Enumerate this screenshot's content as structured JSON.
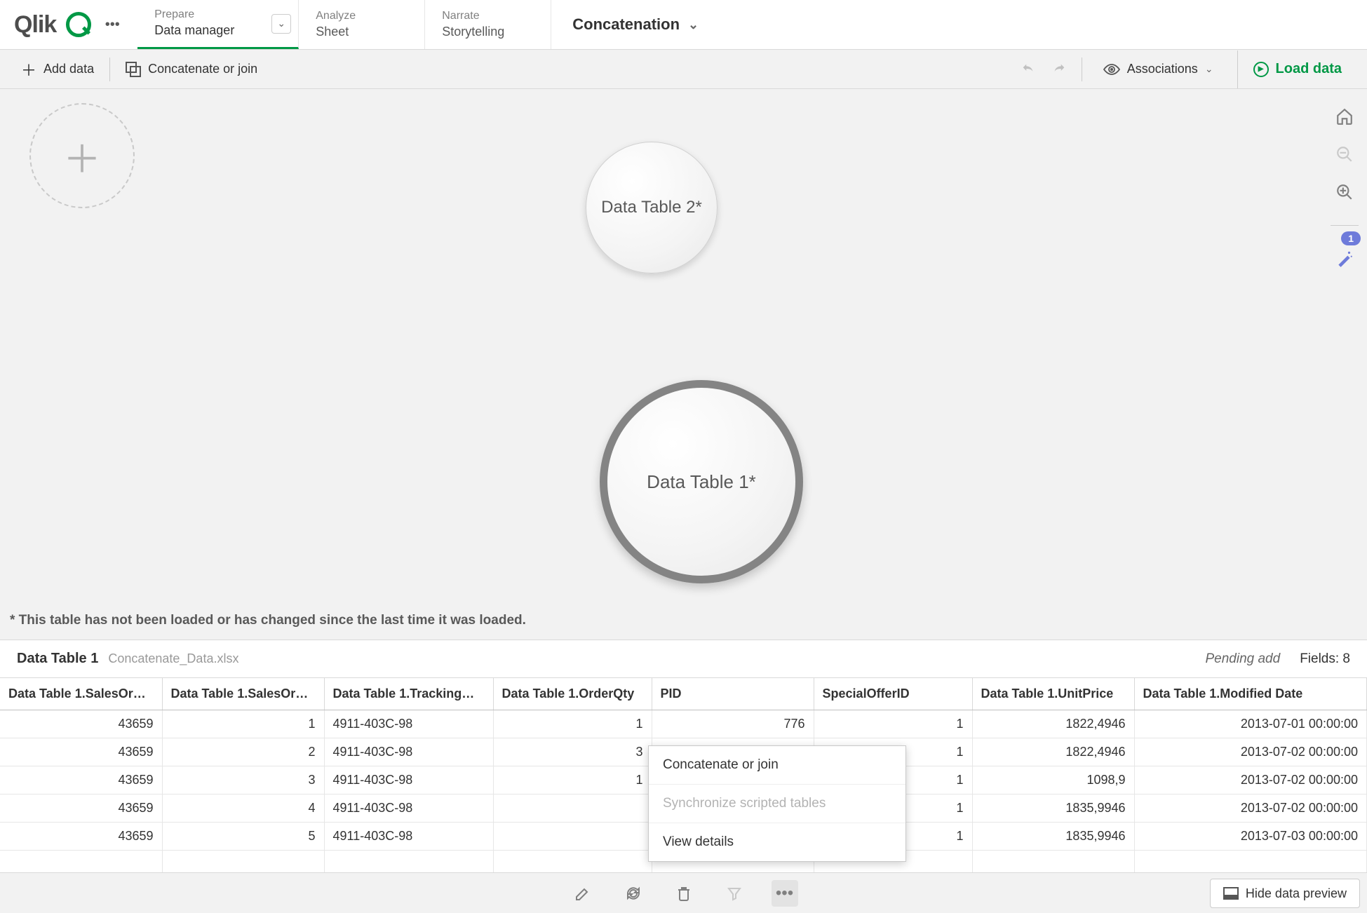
{
  "header": {
    "logo": "Qlik",
    "tabs": [
      {
        "small": "Prepare",
        "main": "Data manager"
      },
      {
        "small": "Analyze",
        "main": "Sheet"
      },
      {
        "small": "Narrate",
        "main": "Storytelling"
      }
    ],
    "app_name": "Concatenation"
  },
  "toolbar": {
    "add_data": "Add data",
    "concat_join": "Concatenate or join",
    "associations": "Associations",
    "load_data": "Load data"
  },
  "canvas": {
    "table2": "Data Table 2*",
    "table1": "Data Table 1*",
    "note": "* This table has not been loaded or has changed since the last time it was loaded.",
    "wand_badge": "1"
  },
  "preview": {
    "title": "Data Table 1",
    "file": "Concatenate_Data.xlsx",
    "pending": "Pending add",
    "fields_label": "Fields: 8"
  },
  "columns": [
    "Data Table 1.SalesOr…",
    "Data Table 1.SalesOr…",
    "Data Table 1.Tracking…",
    "Data Table 1.OrderQty",
    "PID",
    "SpecialOfferID",
    "Data Table 1.UnitPrice",
    "Data Table 1.Modified Date"
  ],
  "rows": [
    [
      "43659",
      "1",
      "4911-403C-98",
      "1",
      "776",
      "1",
      "1822,4946",
      "2013-07-01 00:00:00"
    ],
    [
      "43659",
      "2",
      "4911-403C-98",
      "3",
      "",
      "1",
      "1822,4946",
      "2013-07-02 00:00:00"
    ],
    [
      "43659",
      "3",
      "4911-403C-98",
      "1",
      "",
      "1",
      "1098,9",
      "2013-07-02 00:00:00"
    ],
    [
      "43659",
      "4",
      "4911-403C-98",
      "",
      "",
      "1",
      "1835,9946",
      "2013-07-02 00:00:00"
    ],
    [
      "43659",
      "5",
      "4911-403C-98",
      "",
      "",
      "1",
      "1835,9946",
      "2013-07-03 00:00:00"
    ]
  ],
  "context_menu": {
    "item1": "Concatenate or join",
    "item2": "Synchronize scripted tables",
    "item3": "View details"
  },
  "bottom": {
    "hide_preview": "Hide data preview"
  }
}
